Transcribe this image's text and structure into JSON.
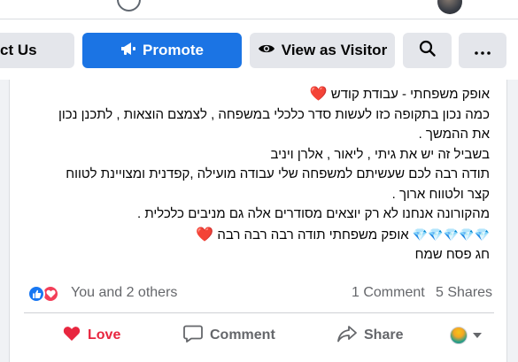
{
  "toolbar": {
    "contact_label": "ct Us",
    "promote_label": "Promote",
    "visitor_label": "View as Visitor",
    "search_icon": "search-icon",
    "more_icon": "more-icon"
  },
  "colors": {
    "accent": "#1b74e4",
    "love": "#e8263f",
    "like": "#1877f2"
  },
  "post": {
    "lines": [
      "אופק משפחתי - עבודת קודש",
      "כמה נכון בתקופה כזו לעשות סדר כלכלי במשפחה , לצמצם הוצאות , לתכנן נכון",
      "את ההמשך .",
      "בשביל זה יש את גיתי , ליאור , אלרן ויניב",
      "תודה רבה לכם שעשיתם למשפחה שלי עבודה מועילה ,קפדנית ומצויינת  לטווח",
      "קצר ולטווח ארוך .",
      "מהקורונה אנחנו לא רק יוצאים מסודרים אלה גם מניבים כלכלית .",
      "אופק משפחתי תודה רבה רבה רבה",
      "חג פסח שמח"
    ],
    "heart_emoji": "❤️",
    "gem_emoji": "💎"
  },
  "engagement": {
    "reactions_text": "You and 2 others",
    "comments_text": "1 Comment",
    "shares_text": "5 Shares"
  },
  "actions": {
    "love_label": "Love",
    "comment_label": "Comment",
    "share_label": "Share"
  }
}
